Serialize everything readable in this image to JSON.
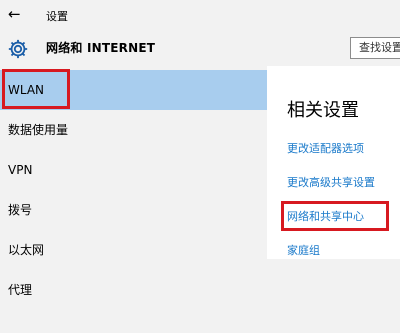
{
  "titlebar": {
    "back_icon": "back-arrow-icon",
    "title": "设置"
  },
  "header": {
    "icon": "gear-icon",
    "title": "网络和 INTERNET",
    "search_placeholder": "查找设置"
  },
  "sidebar": {
    "items": [
      {
        "label": "WLAN",
        "selected": true
      },
      {
        "label": "数据使用量"
      },
      {
        "label": "VPN"
      },
      {
        "label": "拨号"
      },
      {
        "label": "以太网"
      },
      {
        "label": "代理"
      }
    ]
  },
  "related": {
    "heading": "相关设置",
    "links": [
      {
        "label": "更改适配器选项"
      },
      {
        "label": "更改高级共享设置"
      },
      {
        "label": "网络和共享中心",
        "highlighted": true
      },
      {
        "label": "家庭组"
      }
    ]
  },
  "colors": {
    "selection": "#a8cdee",
    "link": "#1979ca",
    "highlight_box": "#d71920",
    "background": "#f2f2f2"
  }
}
